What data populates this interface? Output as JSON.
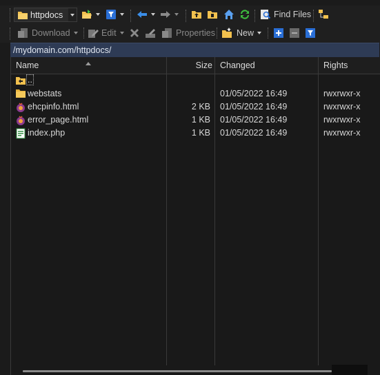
{
  "toolbar1": {
    "location_combo": "httpdocs",
    "find_files_label": "Find Files"
  },
  "toolbar2": {
    "download_label": "Download",
    "edit_label": "Edit",
    "properties_label": "Properties",
    "new_label": "New"
  },
  "path": "/mydomain.com/httpdocs/",
  "columns": {
    "name": "Name",
    "size": "Size",
    "changed": "Changed",
    "rights": "Rights"
  },
  "parent_dir": "..",
  "files": [
    {
      "name": "webstats",
      "size": "",
      "changed": "01/05/2022 16:49",
      "rights": "rwxrwxr-x",
      "icon": "folder-icon"
    },
    {
      "name": "ehcpinfo.html",
      "size": "2 KB",
      "changed": "01/05/2022 16:49",
      "rights": "rwxrwxr-x",
      "icon": "html-file-icon"
    },
    {
      "name": "error_page.html",
      "size": "1 KB",
      "changed": "01/05/2022 16:49",
      "rights": "rwxrwxr-x",
      "icon": "html-file-icon"
    },
    {
      "name": "index.php",
      "size": "1 KB",
      "changed": "01/05/2022 16:49",
      "rights": "rwxrwxr-x",
      "icon": "php-file-icon"
    }
  ],
  "colors": {
    "path_bar_bg": "#2e3b55",
    "folder": "#f2c14e",
    "accent_blue": "#3b8ee8",
    "green": "#3fbf3f"
  }
}
